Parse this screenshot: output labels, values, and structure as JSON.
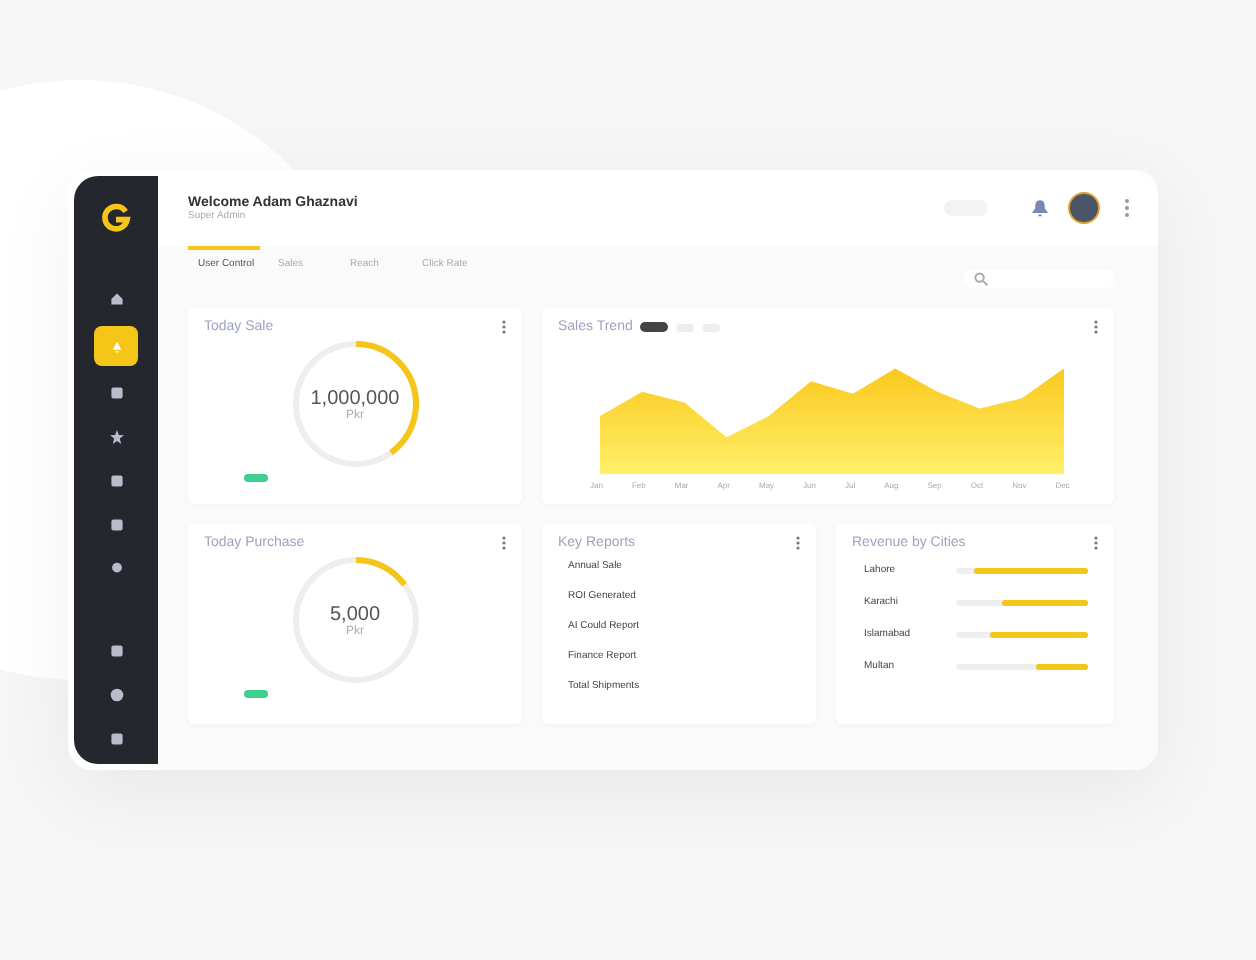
{
  "header": {
    "title": "Welcome Adam Ghaznavi",
    "subtitle": "Super Admin"
  },
  "sidebar": {
    "items": [
      {
        "selected": false
      },
      {
        "selected": true
      },
      {
        "selected": false
      },
      {
        "selected": false
      },
      {
        "selected": false
      },
      {
        "selected": false
      },
      {
        "selected": false
      },
      {
        "selected": false
      },
      {
        "selected": false
      },
      {
        "selected": false
      }
    ]
  },
  "tabs": [
    {
      "label": "User Control",
      "selected": true
    },
    {
      "label": "Sales",
      "selected": false
    },
    {
      "label": "Reach",
      "selected": false
    },
    {
      "label": "Click Rate",
      "selected": false
    }
  ],
  "today_sale": {
    "title": "Today Sale",
    "value": "1,000,000",
    "unit": "Pkr",
    "level": 0.4
  },
  "sales_trend": {
    "title": "Sales Trend",
    "periods": [
      {
        "selected": true
      },
      {
        "selected": false
      },
      {
        "selected": false
      }
    ],
    "months": [
      "Jan",
      "Feb",
      "Mar",
      "Apr",
      "May",
      "Jun",
      "Jul",
      "Aug",
      "Sep",
      "Oct",
      "Nov",
      "Dec"
    ]
  },
  "today_purchase": {
    "title": "Today Purchase",
    "value": "5,000",
    "unit": "Pkr",
    "level": 0.15
  },
  "key_reports": {
    "title": "Key Reports",
    "items": [
      "Annual Sale",
      "ROI Generated",
      "AI Could Report",
      "Finance Report",
      "Total Shipments"
    ]
  },
  "revenue_by_cities": {
    "title": "Revenue by Cities",
    "cities": [
      {
        "name": "Lahore",
        "level": 0.86
      },
      {
        "name": "Karachi",
        "level": 0.65
      },
      {
        "name": "Islamabad",
        "level": 0.75
      },
      {
        "name": "Multan",
        "level": 0.4
      }
    ]
  }
}
